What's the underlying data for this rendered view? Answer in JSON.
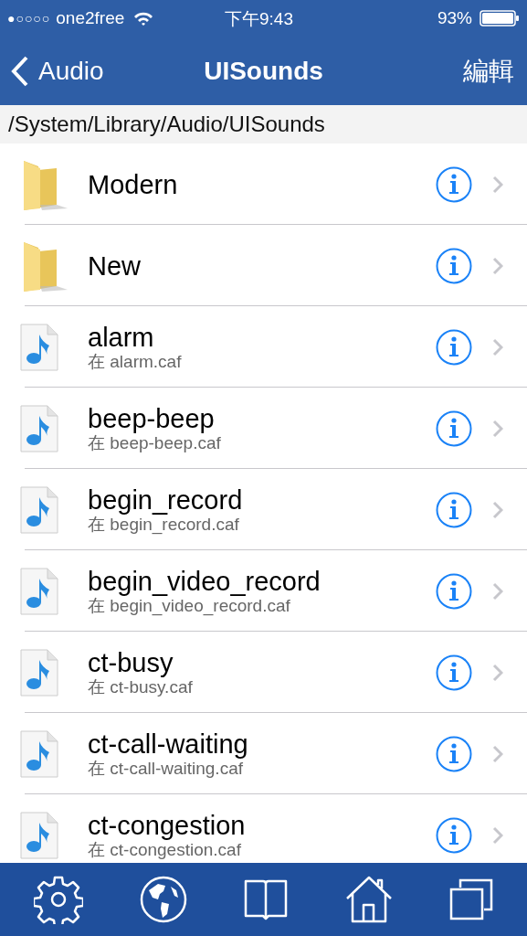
{
  "status_bar": {
    "signal_dots": "●○○○○",
    "carrier": "one2free",
    "time": "下午9:43",
    "battery": "93%"
  },
  "nav_bar": {
    "back": "Audio",
    "title": "UISounds",
    "edit": "編輯"
  },
  "path": "/System/Library/Audio/UISounds",
  "items": [
    {
      "kind": "folder",
      "name": "Modern"
    },
    {
      "kind": "folder",
      "name": "New"
    },
    {
      "kind": "sound",
      "name": "alarm",
      "subtitle": "在 alarm.caf"
    },
    {
      "kind": "sound",
      "name": "beep-beep",
      "subtitle": "在 beep-beep.caf"
    },
    {
      "kind": "sound",
      "name": "begin_record",
      "subtitle": "在 begin_record.caf"
    },
    {
      "kind": "sound",
      "name": "begin_video_record",
      "subtitle": "在 begin_video_record.caf"
    },
    {
      "kind": "sound",
      "name": "ct-busy",
      "subtitle": "在 ct-busy.caf"
    },
    {
      "kind": "sound",
      "name": "ct-call-waiting",
      "subtitle": "在 ct-call-waiting.caf"
    },
    {
      "kind": "sound",
      "name": "ct-congestion",
      "subtitle": "在 ct-congestion.caf"
    }
  ]
}
